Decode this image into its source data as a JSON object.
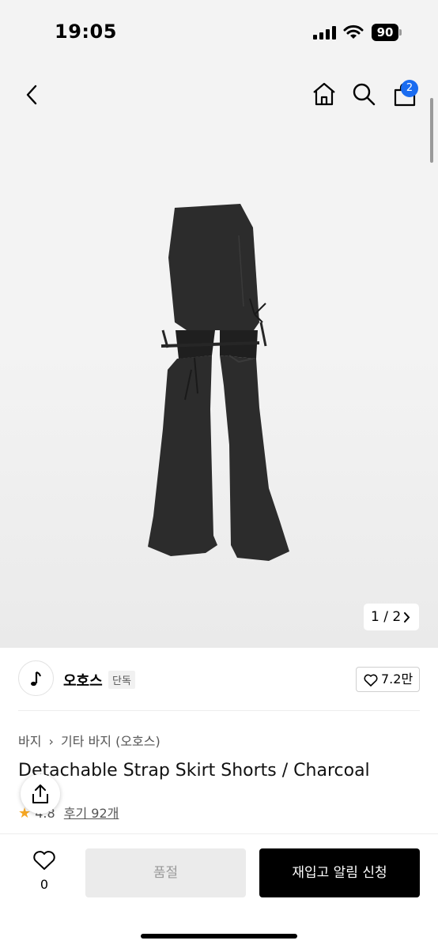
{
  "status_bar": {
    "time": "19:05",
    "battery": "90"
  },
  "nav": {
    "cart_count": "2"
  },
  "gallery": {
    "pager": "1 / 2"
  },
  "brand": {
    "name": "오호스",
    "tag": "단독",
    "likes": "7.2만"
  },
  "breadcrumb": [
    "바지",
    "기타 바지 (오호스)"
  ],
  "product": {
    "title": "Detachable Strap Skirt Shorts / Charcoal",
    "rating": "4.8",
    "reviews_label": "후기 92개"
  },
  "bottom_bar": {
    "wish_count": "0",
    "soldout_label": "품절",
    "restock_label": "재입고 알림 신청"
  },
  "colors": {
    "accent": "#1a6cf0",
    "garment": "#2c2c2c",
    "star": "#f5a623"
  }
}
